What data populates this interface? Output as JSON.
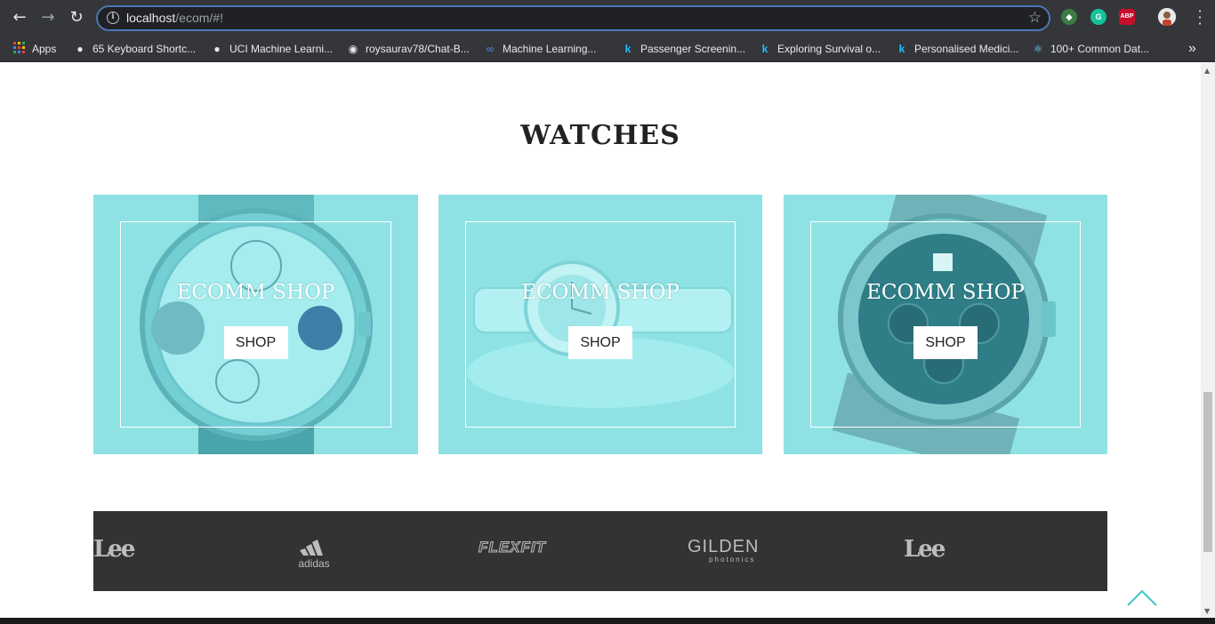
{
  "browser": {
    "url_host": "localhost",
    "url_path": "/ecom/#!",
    "bookmarks": [
      {
        "label": "Apps",
        "icon": "apps-grid-icon"
      },
      {
        "label": "65 Keyboard Shortc...",
        "icon": "globe-icon"
      },
      {
        "label": "UCI Machine Learni...",
        "icon": "globe-icon"
      },
      {
        "label": "roysaurav78/Chat-B...",
        "icon": "github-icon"
      },
      {
        "label": "Machine Learning...",
        "icon": "infinity-icon"
      },
      {
        "label": "Passenger Screenin...",
        "icon": "kaggle-icon"
      },
      {
        "label": "Exploring Survival o...",
        "icon": "kaggle-icon"
      },
      {
        "label": "Personalised Medici...",
        "icon": "kaggle-icon"
      },
      {
        "label": "100+ Common Dat...",
        "icon": "react-icon"
      }
    ],
    "extensions": {
      "grammarly": "G",
      "adblock": "ABP"
    },
    "more_bookmarks": "»"
  },
  "page": {
    "section_title": "WATCHES",
    "cards": [
      {
        "title": "ECOMM SHOP",
        "button": "SHOP"
      },
      {
        "title": "ECOMM SHOP",
        "button": "SHOP"
      },
      {
        "title": "ECOMM SHOP",
        "button": "SHOP"
      }
    ],
    "brands": [
      "Lee",
      "adidas",
      "FLEXFIT",
      "GILDEN",
      "photonics",
      "Lee"
    ]
  },
  "colors": {
    "card_overlay": "#8ee2e4",
    "brand_bar": "#333333",
    "accent": "#3fc4c9"
  }
}
